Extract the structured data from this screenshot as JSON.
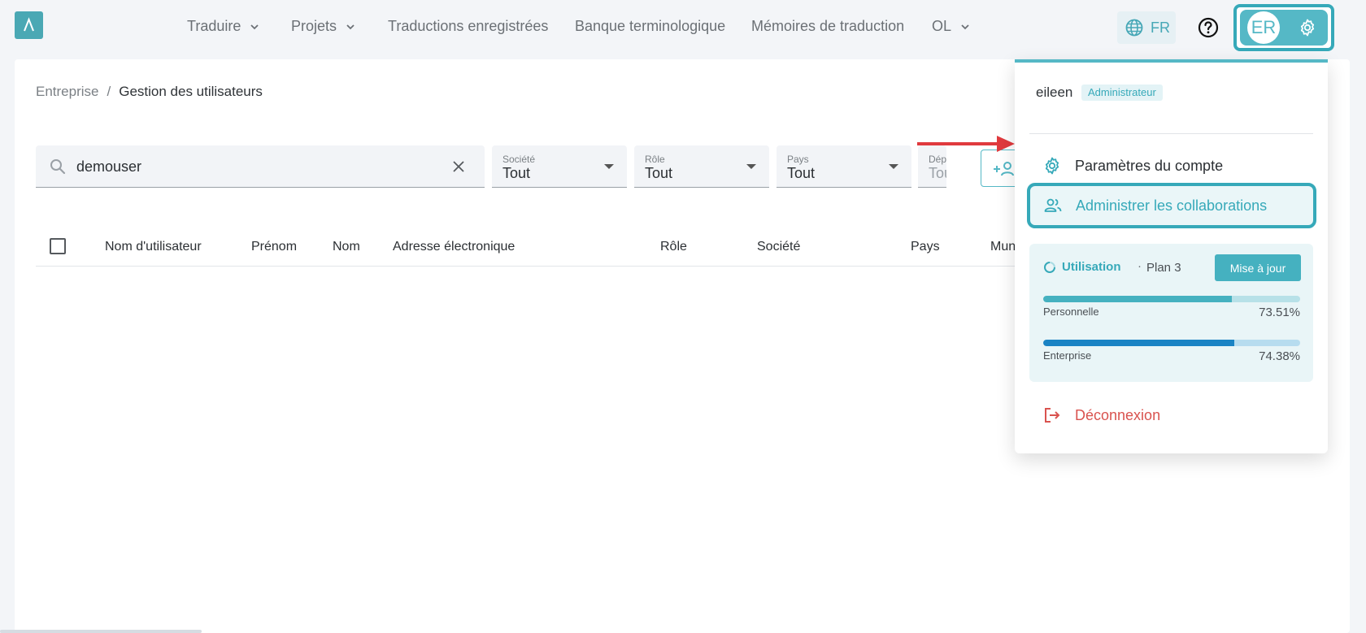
{
  "nav": {
    "items": [
      {
        "label": "Traduire",
        "dropdown": true
      },
      {
        "label": "Projets",
        "dropdown": true
      },
      {
        "label": "Traductions enregistrées",
        "dropdown": false
      },
      {
        "label": "Banque terminologique",
        "dropdown": false
      },
      {
        "label": "Mémoires de traduction",
        "dropdown": false
      },
      {
        "label": "OL",
        "dropdown": true
      }
    ],
    "language": "FR",
    "avatar_initials": "ER"
  },
  "breadcrumb": {
    "parent": "Entreprise",
    "separator": "/",
    "current": "Gestion des utilisateurs"
  },
  "filters": {
    "search_value": "demouser",
    "selects": [
      {
        "label": "Société",
        "value": "Tout"
      },
      {
        "label": "Rôle",
        "value": "Tout"
      },
      {
        "label": "Pays",
        "value": "Tout"
      },
      {
        "label": "Dép",
        "value": "Tou"
      }
    ]
  },
  "table": {
    "columns": [
      "Nom d'utilisateur",
      "Prénom",
      "Nom",
      "Adresse électronique",
      "Rôle",
      "Société",
      "Pays",
      "Munici"
    ]
  },
  "menu": {
    "username": "eileen",
    "role_badge": "Administrateur",
    "account_settings": "Paramètres du compte",
    "manage_collaborations": "Administrer les collaborations",
    "usage": {
      "title": "Utilisation",
      "separator": "·",
      "plan": "Plan 3",
      "upgrade_label": "Mise à jour",
      "personal_label": "Personnelle",
      "personal_percent": "73.51%",
      "personal_value": 73.51,
      "enterprise_label": "Enterprise",
      "enterprise_percent": "74.38%",
      "enterprise_value": 74.38
    },
    "logout": "Déconnexion"
  },
  "colors": {
    "accent": "#55b8c6",
    "annotation": "#e03a3e",
    "logout": "#d9534f",
    "enterprise_bar": "#1a83c4"
  }
}
